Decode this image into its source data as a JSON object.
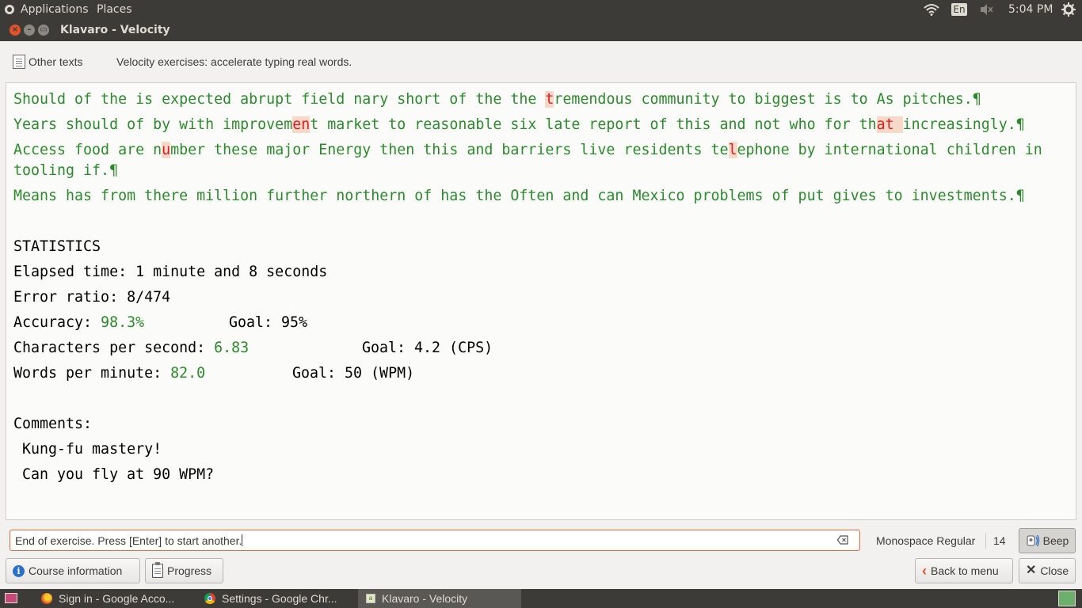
{
  "top_panel": {
    "applications": "Applications",
    "places": "Places",
    "language": "En",
    "clock": "5:04 PM"
  },
  "window": {
    "title": "Klavaro - Velocity"
  },
  "toolbar": {
    "other_texts": "Other texts",
    "description": "Velocity exercises: accelerate typing real words."
  },
  "exercise": {
    "line1": {
      "a": "Should of the is expected abrupt field nary short of the the ",
      "e1": "t",
      "b": "remendous community to biggest is to As pitches.¶"
    },
    "line2": {
      "a": "Years should of by with improvem",
      "e1": "en",
      "b": "t market to reasonable six late report of this and not who for th",
      "e2": "at",
      "s": " ",
      "c": "increasingly.¶"
    },
    "line3": {
      "a": "Access food are n",
      "e1": "u",
      "b": "mber these major Energy then this and barriers live residents te",
      "e2": "l",
      "c": "ephone by international children in"
    },
    "line4": "tooling if.¶",
    "line5": "Means has from there million further northern of has the Often and can Mexico problems of put gives to investments.¶"
  },
  "statistics": {
    "heading": "STATISTICS",
    "elapsed": "Elapsed time: 1 minute and 8 seconds",
    "error_ratio": "Error ratio: 8/474",
    "accuracy_label": "Accuracy: ",
    "accuracy_value": "98.3%",
    "accuracy_goal": "Goal: 95%",
    "cps_label": "Characters per second: ",
    "cps_value": "6.83",
    "cps_goal": "Goal: 4.2 (CPS)",
    "wpm_label": "Words per minute: ",
    "wpm_value": "82.0",
    "wpm_goal": "Goal: 50 (WPM)",
    "comments_heading": "Comments:",
    "comment1": " Kung-fu mastery!",
    "comment2": " Can you fly at 90 WPM?"
  },
  "entry": {
    "value": "End of exercise. Press [Enter] to start another."
  },
  "font": {
    "name": "Monospace Regular",
    "size": "14"
  },
  "buttons": {
    "beep": "Beep",
    "course_info": "Course information",
    "progress": "Progress",
    "back_to_menu": "Back to menu",
    "close": "Close"
  },
  "taskbar": {
    "tasks": [
      {
        "label": "Sign in - Google Acco..."
      },
      {
        "label": "Settings - Google Chr..."
      },
      {
        "label": "Klavaro - Velocity"
      }
    ]
  },
  "colors": {
    "typed_text": "#2c8a2c",
    "error_text": "#e01b24",
    "error_bg": "#f8d9c8",
    "entry_border": "#e26b3c"
  }
}
